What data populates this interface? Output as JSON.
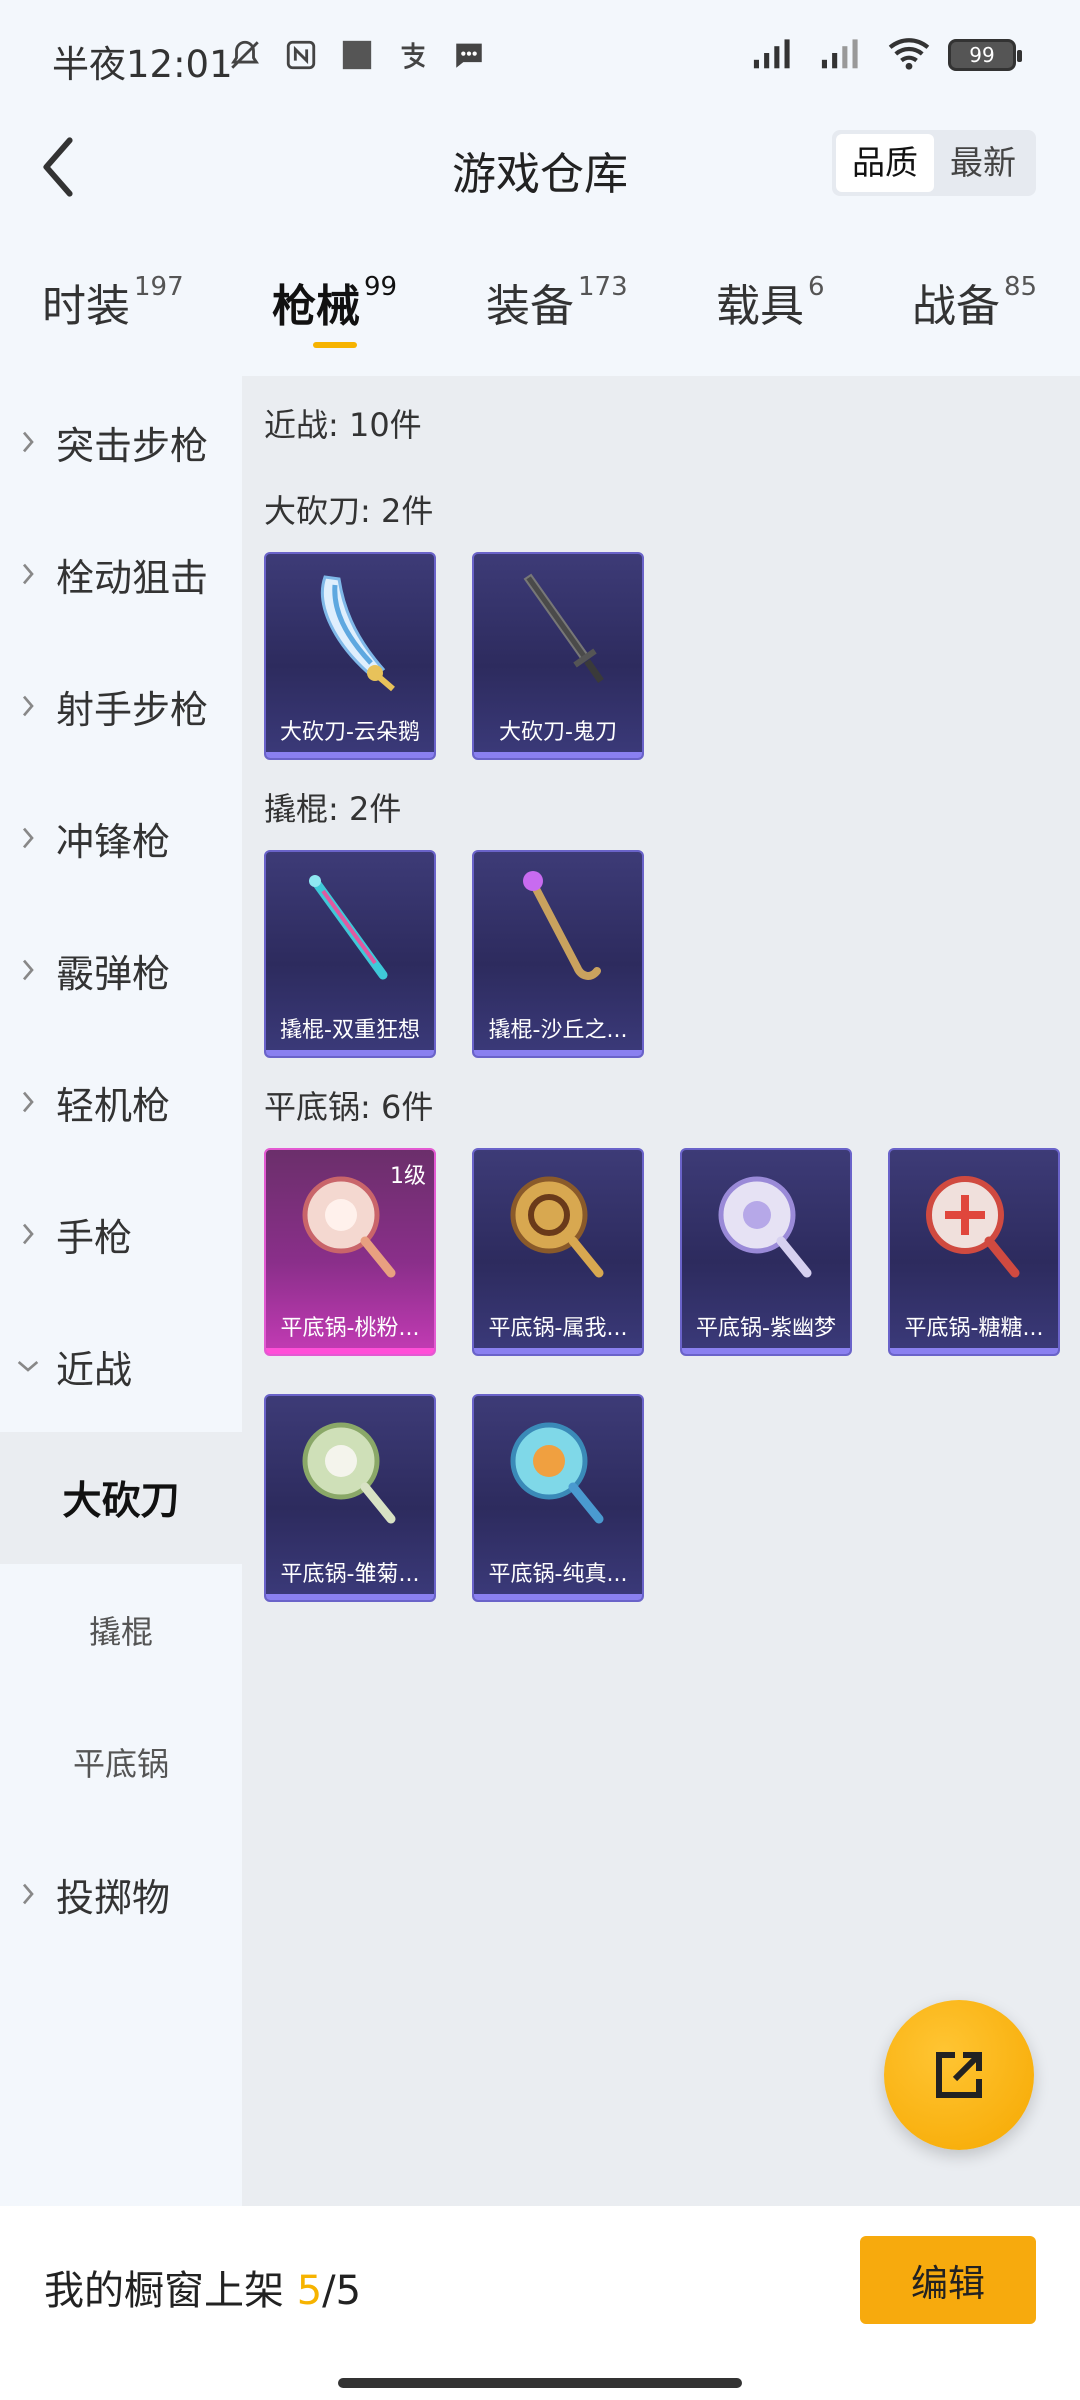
{
  "status_bar": {
    "time": "半夜12:01",
    "battery": "99"
  },
  "header": {
    "title": "游戏仓库",
    "sort_options": [
      "品质",
      "最新"
    ],
    "active_sort": "品质"
  },
  "tabs": [
    {
      "label": "时装",
      "count": "197"
    },
    {
      "label": "枪械",
      "count": "99"
    },
    {
      "label": "装备",
      "count": "173"
    },
    {
      "label": "载具",
      "count": "6"
    },
    {
      "label": "战备",
      "count": "85"
    }
  ],
  "active_tab": "枪械",
  "sidebar": {
    "items": [
      {
        "label": "突击步枪"
      },
      {
        "label": "栓动狙击"
      },
      {
        "label": "射手步枪"
      },
      {
        "label": "冲锋枪"
      },
      {
        "label": "霰弹枪"
      },
      {
        "label": "轻机枪"
      },
      {
        "label": "手枪"
      },
      {
        "label": "近战"
      }
    ],
    "sub_items": [
      {
        "label": "大砍刀"
      },
      {
        "label": "撬棍"
      },
      {
        "label": "平底锅"
      }
    ],
    "last_item": {
      "label": "投掷物"
    }
  },
  "main": {
    "total": "近战: 10件",
    "sections": [
      {
        "title": "大砍刀: 2件",
        "items": [
          {
            "name": "大砍刀-云朵鹅"
          },
          {
            "name": "大砍刀-鬼刀"
          }
        ]
      },
      {
        "title": "撬棍: 2件",
        "items": [
          {
            "name": "撬棍-双重狂想"
          },
          {
            "name": "撬棍-沙丘之..."
          }
        ]
      },
      {
        "title": "平底锅: 6件",
        "items": [
          {
            "name": "平底锅-桃粉...",
            "level": "1级"
          },
          {
            "name": "平底锅-属我..."
          },
          {
            "name": "平底锅-紫幽梦"
          },
          {
            "name": "平底锅-糖糖..."
          },
          {
            "name": "平底锅-雏菊..."
          },
          {
            "name": "平底锅-纯真..."
          }
        ]
      }
    ]
  },
  "bottom": {
    "label": "我的橱窗上架 ",
    "count": "5",
    "total": "/5",
    "edit_label": "编辑"
  },
  "colors": {
    "accent": "#f7aa0d",
    "card_purple": "#3d3b77",
    "card_pink": "#c43bb5"
  }
}
